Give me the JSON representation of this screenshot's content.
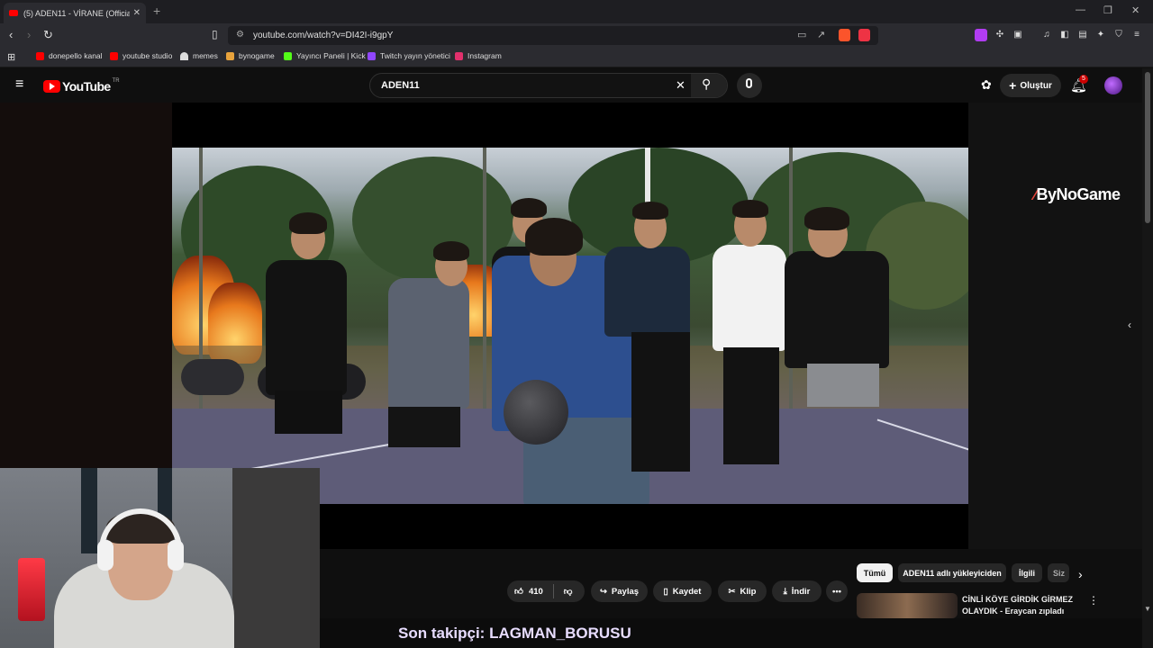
{
  "browser": {
    "tab_title": "(5) ADEN11 - VİRANE (Official Vi",
    "url": "youtube.com/watch?v=DI42I-i9gpY",
    "bookmarks": [
      {
        "label": "donepello kanal",
        "color": "#ff0000"
      },
      {
        "label": "youtube studio",
        "color": "#ff0000"
      },
      {
        "label": "memes",
        "color": "#dddddd"
      },
      {
        "label": "bynogame",
        "color": "#e8a33c"
      },
      {
        "label": "Yayıncı Paneli | Kick",
        "color": "#53fc18"
      },
      {
        "label": "Twitch yayın yönetici",
        "color": "#9146ff"
      },
      {
        "label": "Instagram",
        "color": "#e1306c"
      }
    ]
  },
  "youtube": {
    "logo_text": "YouTube",
    "country_code": "TR",
    "search_query": "ADEN11",
    "create_label": "Oluştur",
    "notification_count": "5"
  },
  "overlay": {
    "sponsor_logo": "ByNoGame",
    "last_follower": "Son takipçi: LAGMAN_BORUSU"
  },
  "actions": {
    "like_count": "410",
    "share": "Paylaş",
    "save": "Kaydet",
    "clip": "Klip",
    "download": "İndir"
  },
  "filter_chips": [
    "Tümü",
    "ADEN11 adlı yükleyiciden",
    "İlgili",
    "Siz"
  ],
  "recommended": [
    {
      "title": "CİNLİ KÖYE GİRDİK GİRMEZ OLAYDIK - Eraycan zıpladı"
    }
  ]
}
